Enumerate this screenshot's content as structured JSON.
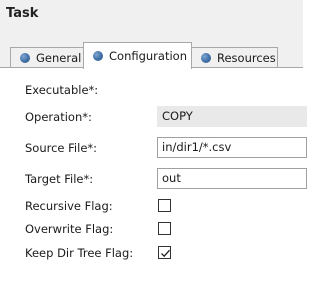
{
  "header": {
    "title": "Task"
  },
  "tabs": [
    {
      "label": "General",
      "active": false
    },
    {
      "label": "Configuration",
      "active": true
    },
    {
      "label": "Resources",
      "active": false
    }
  ],
  "form": {
    "executable_label": "Executable*:",
    "operation_label": "Operation*:",
    "operation_value": "COPY",
    "source_file_label": "Source File*:",
    "source_file_value": "in/dir1/*.csv",
    "target_file_label": "Target File*:",
    "target_file_value": "out",
    "recursive_label": "Recursive Flag:",
    "recursive_checked": false,
    "overwrite_label": "Overwrite Flag:",
    "overwrite_checked": false,
    "keep_dir_tree_label": "Keep Dir Tree Flag:",
    "keep_dir_tree_checked": true
  }
}
